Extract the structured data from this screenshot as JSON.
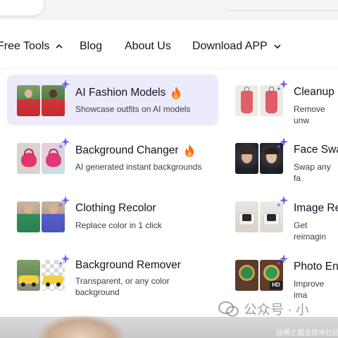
{
  "nav": {
    "items": [
      {
        "label": "Free Tools",
        "has_chevron": true,
        "chevron": "chevron-up-icon"
      },
      {
        "label": "Blog"
      },
      {
        "label": "About Us"
      },
      {
        "label": "Download APP",
        "has_chevron": true,
        "chevron": "chevron-down-icon"
      }
    ]
  },
  "menu": {
    "left": [
      {
        "title": "AI Fashion Models",
        "badge_icon": "fire-icon",
        "description": "Showcase outfits on AI models",
        "active": true
      },
      {
        "title": "Background Changer",
        "badge_icon": "fire-icon",
        "description": "AI generated instant backgrounds"
      },
      {
        "title": "Clothing Recolor",
        "description": "Replace color in 1 click"
      },
      {
        "title": "Background Remover",
        "description": "Transparent, or any color background"
      }
    ],
    "right": [
      {
        "title": "Cleanup P",
        "description": "Remove unw"
      },
      {
        "title": "Face Swa",
        "description": "Swap any fa"
      },
      {
        "title": "Image Re",
        "description": "Get reimagin"
      },
      {
        "title": "Photo En",
        "description": "Improve ima",
        "thumb_badge": "HD"
      }
    ]
  },
  "watermark": {
    "text": "公众号 · 小",
    "sub": "@稀土掘金技术社区"
  },
  "colors": {
    "active_bg": "#ecebfb",
    "sparkle": "#6f5ef0",
    "fire": "#ff6a1a"
  }
}
